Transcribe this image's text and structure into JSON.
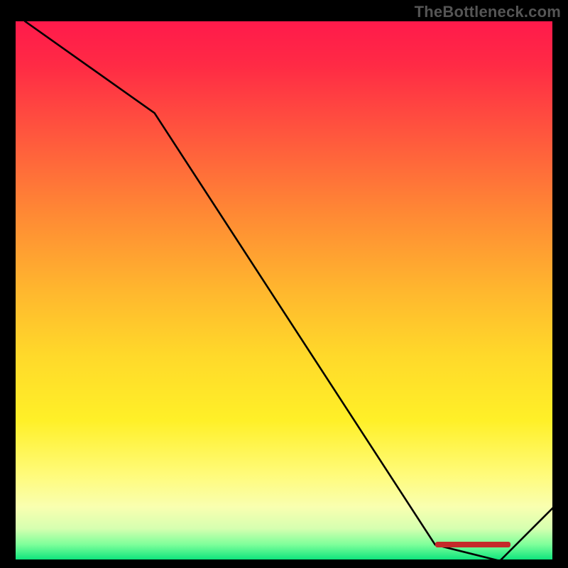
{
  "watermark": "TheBottleneck.com",
  "chart_data": {
    "type": "line",
    "title": "",
    "xlabel": "",
    "ylabel": "",
    "xlim": [
      0,
      100
    ],
    "ylim": [
      0,
      100
    ],
    "grid": false,
    "curve": {
      "x": [
        2,
        26,
        78,
        90,
        100
      ],
      "value": [
        100,
        83,
        3,
        0,
        10
      ]
    },
    "gradient_stops": [
      {
        "pos": 0,
        "color": "#ff1a4b"
      },
      {
        "pos": 22,
        "color": "#ff5a3d"
      },
      {
        "pos": 50,
        "color": "#ffb72e"
      },
      {
        "pos": 74,
        "color": "#fff028"
      },
      {
        "pos": 90,
        "color": "#f9ffb0"
      },
      {
        "pos": 100,
        "color": "#05e27b"
      }
    ],
    "marker": {
      "x_range": [
        78,
        92
      ],
      "value": 3,
      "color": "#c42a2a"
    }
  }
}
